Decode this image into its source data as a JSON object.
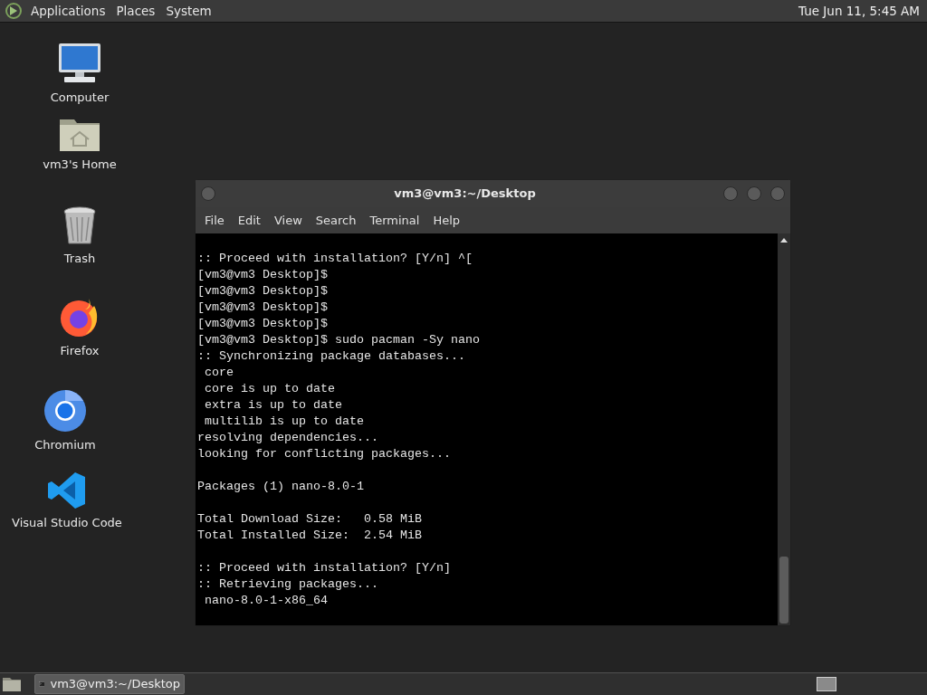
{
  "top_panel": {
    "menus": [
      "Applications",
      "Places",
      "System"
    ],
    "clock": "Tue Jun 11, 5:45 AM"
  },
  "desktop_icons": [
    {
      "kind": "computer",
      "label": "Computer"
    },
    {
      "kind": "home",
      "label": "vm3's Home"
    },
    {
      "kind": "trash",
      "label": "Trash"
    },
    {
      "kind": "firefox",
      "label": "Firefox"
    },
    {
      "kind": "chromium",
      "label": "Chromium"
    },
    {
      "kind": "vscode",
      "label": "Visual Studio Code"
    }
  ],
  "terminal": {
    "title": "vm3@vm3:~/Desktop",
    "menu": [
      "File",
      "Edit",
      "View",
      "Search",
      "Terminal",
      "Help"
    ],
    "blocks": [
      [
        ":: Proceed with installation? [Y/n] ^[",
        "[vm3@vm3 Desktop]$",
        "[vm3@vm3 Desktop]$",
        "[vm3@vm3 Desktop]$",
        "[vm3@vm3 Desktop]$",
        "[vm3@vm3 Desktop]$ sudo pacman -Sy nano",
        ":: Synchronizing package databases...",
        " core",
        " core is up to date",
        " extra is up to date",
        " multilib is up to date",
        "resolving dependencies...",
        "looking for conflicting packages..."
      ],
      [
        "Packages (1) nano-8.0-1"
      ],
      [
        "Total Download Size:   0.58 MiB",
        "Total Installed Size:  2.54 MiB"
      ],
      [
        ":: Proceed with installation? [Y/n]",
        ":: Retrieving packages...",
        " nano-8.0-1-x86_64"
      ]
    ]
  },
  "taskbar": {
    "tasks": [
      {
        "label": "vm3@vm3:~/Desktop",
        "selected": true
      }
    ]
  }
}
